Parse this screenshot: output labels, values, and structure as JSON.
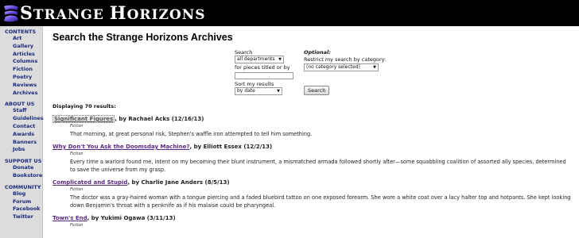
{
  "site": {
    "name_first": "S",
    "name_first_rest": "TRANGE",
    "name_second": "H",
    "name_second_rest": "ORIZONS"
  },
  "sidebar": {
    "sections": [
      {
        "heading": "CONTENTS",
        "items": [
          "Art",
          "Gallery",
          "Articles",
          "Columns",
          "Fiction",
          "Poetry",
          "Reviews",
          "Archives"
        ]
      },
      {
        "heading": "ABOUT US",
        "items": [
          "Staff",
          "Guidelines",
          "Contact",
          "Awards",
          "Banners",
          "Jobs"
        ]
      },
      {
        "heading": "SUPPORT US",
        "items": [
          "Donate",
          "Bookstore"
        ]
      },
      {
        "heading": "COMMUNITY",
        "items": [
          "Blog",
          "Forum",
          "Facebook",
          "Twitter"
        ]
      }
    ]
  },
  "page_title": "Search the Strange Horizons Archives",
  "search_form": {
    "search_label": "Search",
    "department_value": "all departments",
    "pieces_label": "for pieces titled or by",
    "sort_label": "Sort my results",
    "sort_value": "by date",
    "optional_label": "Optional:",
    "restrict_label": "Restrict my search by category:",
    "category_value": "(no category selected)",
    "search_button": "Search"
  },
  "results_count": "Displaying 70 results:",
  "results": [
    {
      "title": "Significant Figures",
      "meta": ", by Rachael Acks (12/16/13)",
      "category": "Fiction",
      "excerpt": "That morning, at great personal risk, Stephen's waffle iron attempted to tell him something."
    },
    {
      "title": "Why Don't You Ask the Doomsday Machine?",
      "meta": ", by Elliott Essex (12/2/13)",
      "category": "Fiction",
      "excerpt": "Every time a warlord found me, intent on my becoming their blunt instrument, a mismatched armada followed shortly after—some squabbling coalition of assorted ally species, determined to save the universe from my grasp."
    },
    {
      "title": "Complicated and Stupid",
      "meta": ", by Charlie Jane Anders (8/5/13)",
      "category": "Fiction",
      "excerpt": "The doctor was a gray-haired woman with a tongue piercing and a faded bluebird tattoo on one exposed forearm. She wore a white coat over a lacy halter top and hotpants. She kept looking down Benjamin's throat with a penknife as if his malaise could be pharyngeal."
    },
    {
      "title": "Town's End",
      "meta": ", by Yukimi Ogawa (3/11/13)",
      "category": "Fiction",
      "excerpt": ""
    }
  ],
  "colors": {
    "masthead_bg": "#000000",
    "sidebar_bg": "#dcdcdc",
    "nav_link": "#1a2a7c",
    "result_link": "#5b2a86"
  }
}
